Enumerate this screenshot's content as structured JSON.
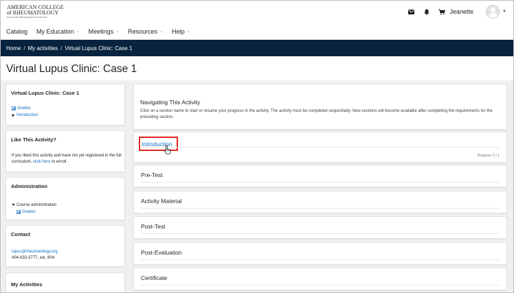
{
  "logo": {
    "line1": "AMERICAN COLLEGE",
    "line2": "of RHEUMATOLOGY",
    "tagline": "Empowering Rheumatology Professionals"
  },
  "header": {
    "user_name": "Jeanette",
    "icons": [
      "envelope-icon",
      "bell-icon",
      "cart-icon",
      "avatar-icon"
    ]
  },
  "nav": {
    "items": [
      "Catalog",
      "My Education",
      "Meetings",
      "Resources",
      "Help"
    ]
  },
  "breadcrumb": {
    "items": [
      "Home",
      "My activities",
      "Virtual Lupus Clinic: Case 1"
    ],
    "separator": "/"
  },
  "page": {
    "title": "Virtual Lupus Clinic: Case 1"
  },
  "sidebar": {
    "course_block": {
      "title": "Virtual Lupus Clinic: Case 1",
      "links": [
        "Grades",
        "Introduction"
      ]
    },
    "like_block": {
      "title": "Like This Activity?",
      "text_before": "If you liked this activity and have not yet registered in the full curriculum,",
      "link": "click here",
      "text_after": "to enroll."
    },
    "admin_block": {
      "title": "Administration",
      "item": "Course administration",
      "subitem": "Grades"
    },
    "contact_block": {
      "title": "Contact",
      "email": "lupus@rheumatology.org",
      "phone": "404-633-3777, ext. 804"
    },
    "activities_block": {
      "title": "My Activities"
    }
  },
  "main": {
    "intro_card": {
      "heading": "Navigating This Activity",
      "text": "Click on a section name to start or resume your progress in the activity. The activity must be completed sequentially. New sections will become available after completing the requirements for the preceding section."
    },
    "sections": [
      {
        "name": "Introduction",
        "progress": "Progress: 0 / 1"
      },
      {
        "name": "Pre-Test"
      },
      {
        "name": "Activity Material"
      },
      {
        "name": "Post-Test"
      },
      {
        "name": "Post-Evaluation"
      },
      {
        "name": "Certificate"
      }
    ]
  },
  "colors": {
    "breadcrumb_bg": "#08233e",
    "link": "#0f6cbf",
    "highlight_box": "#e0261f"
  }
}
